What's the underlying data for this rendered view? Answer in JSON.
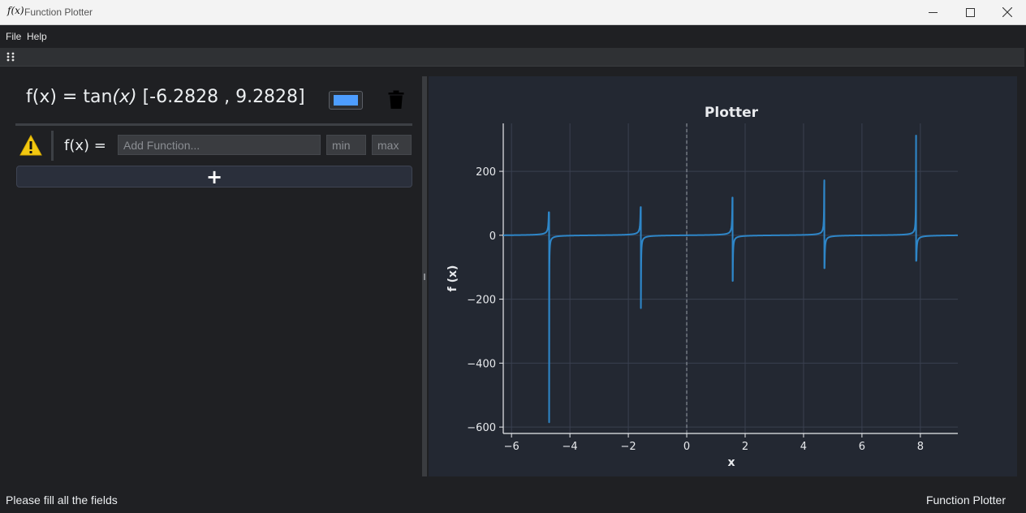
{
  "window": {
    "icon_text": "f(x)",
    "title": "Function Plotter",
    "controls": {
      "minimize": "─",
      "maximize": "☐",
      "close": "✕"
    }
  },
  "menu": {
    "items": [
      "File",
      "Help"
    ]
  },
  "function_entry": {
    "title_prefix": "f(x) = tan",
    "title_var": "(x)",
    "title_range": "[-6.2828 , 9.2828]",
    "color": "#4d9dff"
  },
  "input_row": {
    "label": "f(x) =",
    "function_placeholder": "Add Function...",
    "min_placeholder": "min",
    "max_placeholder": "max"
  },
  "add_button": {
    "label": "+"
  },
  "status": {
    "left": "Please fill all the fields",
    "right": "Function Plotter"
  },
  "chart_data": {
    "type": "line",
    "title": "Plotter",
    "xlabel": "x",
    "ylabel": "f (x)",
    "xlim": [
      -6.2828,
      9.2828
    ],
    "ylim": [
      -620,
      350
    ],
    "xticks": [
      -6,
      -4,
      -2,
      0,
      2,
      4,
      6,
      8
    ],
    "xtick_labels": [
      "−6",
      "−4",
      "−2",
      "0",
      "2",
      "4",
      "6",
      "8"
    ],
    "yticks": [
      200,
      0,
      -200,
      -400,
      -600
    ],
    "ytick_labels": [
      "200",
      "0",
      "−200",
      "−400",
      "−600"
    ],
    "grid": true,
    "series": [
      {
        "function": "tan(x)",
        "color": "#2e86c8",
        "spikes": [
          {
            "x": -4.712,
            "max": 72,
            "min": -585
          },
          {
            "x": -1.571,
            "max": 88,
            "min": -228
          },
          {
            "x": 1.571,
            "max": 118,
            "min": -143
          },
          {
            "x": 4.712,
            "max": 172,
            "min": -103
          },
          {
            "x": 7.854,
            "max": 312,
            "min": -80
          }
        ]
      }
    ]
  }
}
